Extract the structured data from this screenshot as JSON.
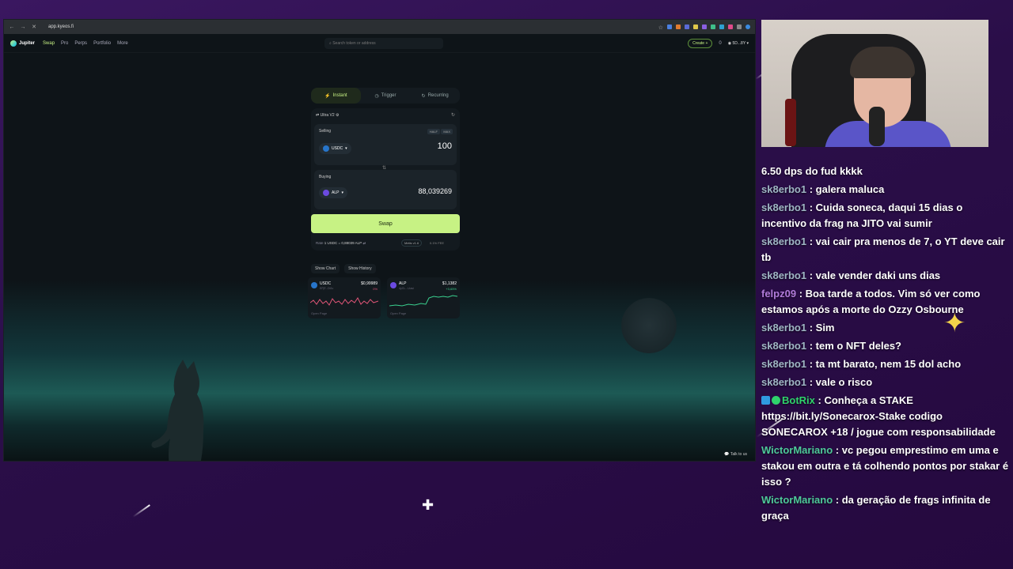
{
  "browser": {
    "url": "app.kyeos.fi"
  },
  "app_nav": {
    "logo": "Jupiter",
    "items": [
      "Swap",
      "Pro",
      "Perps",
      "Portfolio",
      "More"
    ],
    "search_placeholder": "Search token or address",
    "create_label": "Create +",
    "notifications": "0",
    "wallet": "5D...8Y"
  },
  "swap": {
    "tabs": [
      "Instant",
      "Trigger",
      "Recurring"
    ],
    "mode": "Ultra V2",
    "selling_label": "Selling",
    "half_label": "HALF",
    "max_label": "MAX",
    "sell_token": "USDC",
    "sell_amount": "100",
    "buying_label": "Buying",
    "buy_token": "ALP",
    "buy_amount": "88,039269",
    "button": "Swap",
    "rate_label": "Rate",
    "rate_value": "1 USDC = 0,88039 ALP",
    "router": "Metis v1.6",
    "fee": "0.1% FEE"
  },
  "chart_buttons": [
    "Show Chart",
    "Show History"
  ],
  "mini_cards": [
    {
      "name": "USDC",
      "addr": "EPjF...Dt1v",
      "price": "$0,99989",
      "change": "0%",
      "change_color": "#e05577",
      "open": "Open Page"
    },
    {
      "name": "ALP",
      "addr": "4yCL...Uuwi",
      "price": "$1,1382",
      "change": "+3,65%",
      "change_color": "#3ad18f",
      "open": "Open Page"
    }
  ],
  "talk_to_us": "Talk to us",
  "chat": [
    {
      "user": "",
      "text": "6.50 dps do fud kkkk"
    },
    {
      "user": "sk8erbo1",
      "text": " : galera maluca"
    },
    {
      "user": "sk8erbo1",
      "text": " : Cuida soneca, daqui 15 dias o incentivo da frag na JITO vai sumir"
    },
    {
      "user": "sk8erbo1",
      "text": " : vai cair pra menos de 7, o YT deve cair tb"
    },
    {
      "user": "sk8erbo1",
      "text": " : vale vender daki uns dias"
    },
    {
      "user": "felpz09",
      "text": " : Boa tarde a todos. Vim só ver como estamos após a morte do Ozzy Osbourne"
    },
    {
      "user": "sk8erbo1",
      "text": " : Sim"
    },
    {
      "user": "sk8erbo1",
      "text": " : tem o NFT deles?"
    },
    {
      "user": "sk8erbo1",
      "text": " : ta mt barato, nem 15 dol acho"
    },
    {
      "user": "sk8erbo1",
      "text": " : vale o risco"
    },
    {
      "user": "BotRix",
      "text": " : Conheça a STAKE https://bit.ly/Sonecarox-Stake codigo SONECAROX +18 / jogue com responsabilidade"
    },
    {
      "user": "WictorMariano",
      "text": " : vc pegou emprestimo em uma e stakou em outra e tá colhendo pontos por stakar é isso ?"
    },
    {
      "user": "WictorMariano",
      "text": " : da geração de frags infinita de graça"
    }
  ]
}
